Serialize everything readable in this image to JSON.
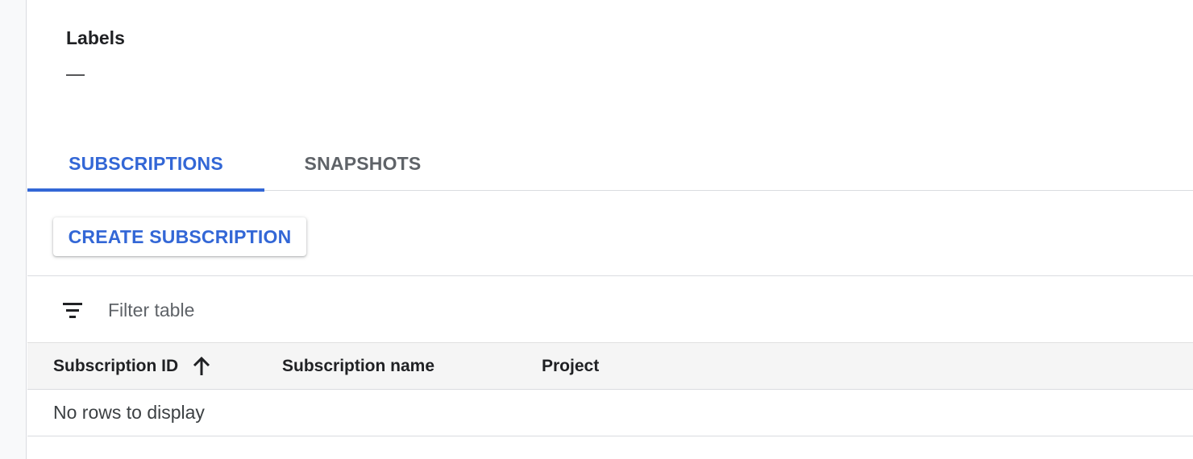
{
  "labels": {
    "title": "Labels",
    "value": "—"
  },
  "tabs": [
    {
      "label": "SUBSCRIPTIONS",
      "active": true
    },
    {
      "label": "SNAPSHOTS",
      "active": false
    }
  ],
  "actions": {
    "create_subscription_label": "CREATE SUBSCRIPTION"
  },
  "filter": {
    "icon": "filter-list-icon",
    "placeholder": "Filter table",
    "value": ""
  },
  "table": {
    "columns": [
      {
        "label": "Subscription ID",
        "sorted": "ascending",
        "sort_icon": "arrow-upward-icon"
      },
      {
        "label": "Subscription name"
      },
      {
        "label": "Project"
      }
    ],
    "rows": [],
    "empty_message": "No rows to display"
  },
  "colors": {
    "accent": "#3367d6",
    "text": "#202124",
    "muted": "#5f6368",
    "header_bg": "#f5f5f5",
    "divider": "#dadce0"
  }
}
